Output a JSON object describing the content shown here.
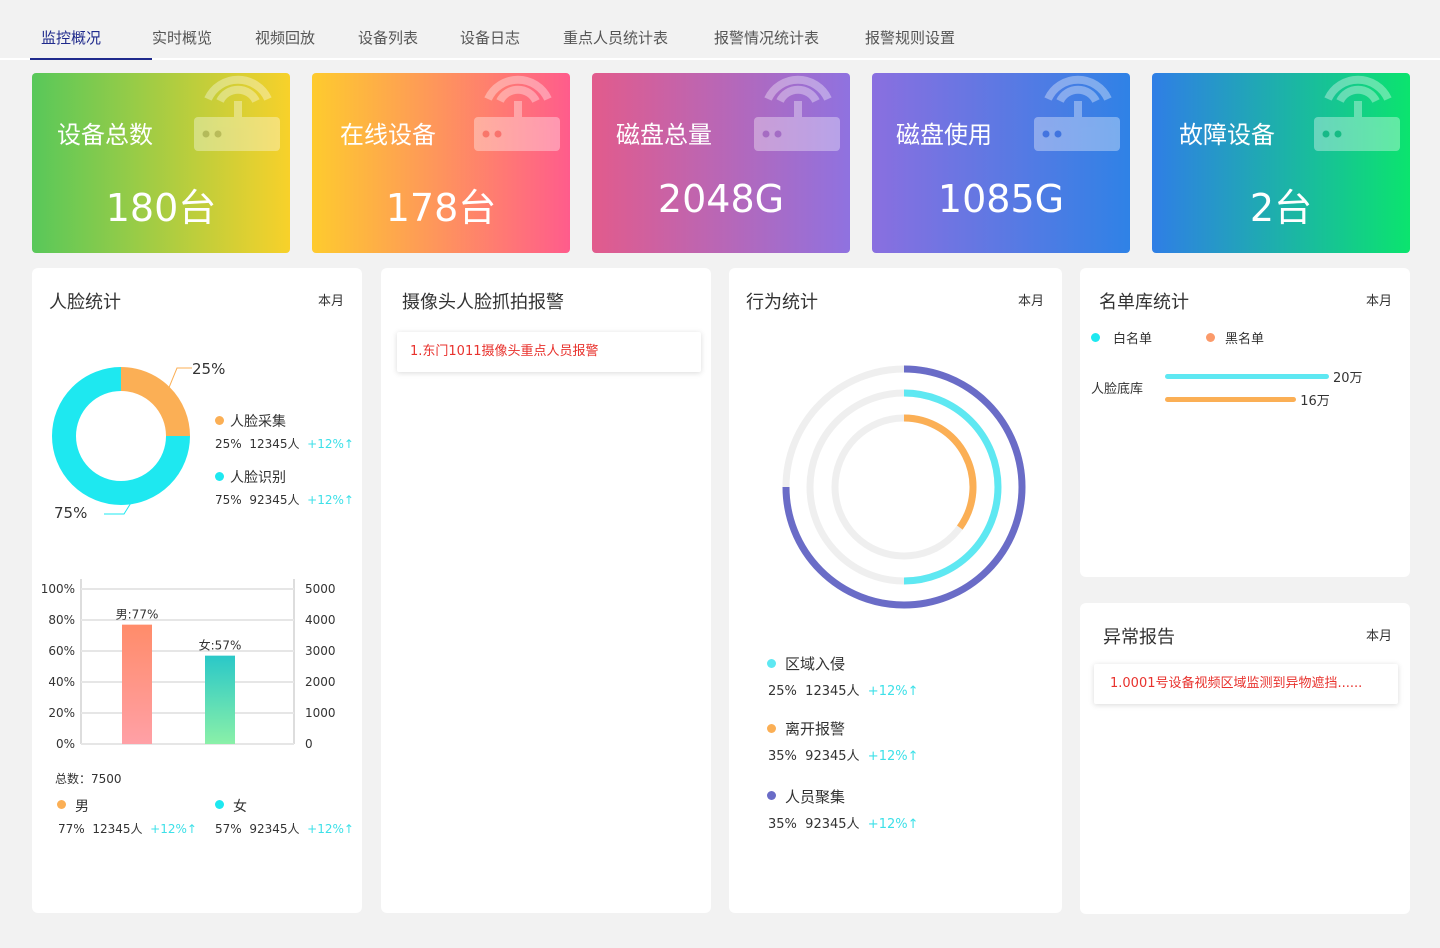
{
  "tabs": [
    "监控概况",
    "实时概览",
    "视频回放",
    "设备列表",
    "设备日志",
    "重点人员统计表",
    "报警情况统计表",
    "报警规则设置"
  ],
  "stats": [
    {
      "label": "设备总数",
      "value": "180台"
    },
    {
      "label": "在线设备",
      "value": "178台"
    },
    {
      "label": "磁盘总量",
      "value": "2048G"
    },
    {
      "label": "磁盘使用",
      "value": "1085G"
    },
    {
      "label": "故障设备",
      "value": "2台"
    }
  ],
  "face": {
    "title": "人脸统计",
    "period": "本月",
    "donut_top_label": "25%",
    "donut_bottom_label": "75%",
    "items": [
      {
        "name": "人脸采集",
        "pct": "25%",
        "count": "12345人",
        "trend": "+12%↑",
        "color": "#fbaf55"
      },
      {
        "name": "人脸识别",
        "pct": "75%",
        "count": "92345人",
        "trend": "+12%↑",
        "color": "#1ee8f0"
      }
    ]
  },
  "gender_chart": {
    "left_ticks": [
      "100%",
      "80%",
      "60%",
      "40%",
      "20%",
      "0%"
    ],
    "right_ticks": [
      "5000",
      "4000",
      "3000",
      "2000",
      "1000",
      "0"
    ],
    "bars": [
      {
        "label": "男:77%",
        "value": 77
      },
      {
        "label": "女:57%",
        "value": 57
      }
    ],
    "total": "总数：7500",
    "items": [
      {
        "name": "男",
        "pct": "77%",
        "count": "12345人",
        "trend": "+12%↑",
        "color": "#fbaf55"
      },
      {
        "name": "女",
        "pct": "57%",
        "count": "92345人",
        "trend": "+12%↑",
        "color": "#1ee8f0"
      }
    ]
  },
  "camera": {
    "title": "摄像头人脸抓拍报警",
    "alert": "1.东门1011摄像头重点人员报警"
  },
  "behavior": {
    "title": "行为统计",
    "period": "本月",
    "items": [
      {
        "name": "区域入侵",
        "pct": "25%",
        "count": "12345人",
        "trend": "+12%↑",
        "color": "#5ee8f2",
        "ratio": 0.5
      },
      {
        "name": "离开报警",
        "pct": "35%",
        "count": "92345人",
        "trend": "+12%↑",
        "color": "#fbaf55",
        "ratio": 0.35
      },
      {
        "name": "人员聚集",
        "pct": "35%",
        "count": "92345人",
        "trend": "+12%↑",
        "color": "#6a6cc7",
        "ratio": 0.75
      }
    ]
  },
  "roster": {
    "title": "名单库统计",
    "period": "本月",
    "legend": [
      {
        "name": "白名单",
        "color": "#1ee8f0"
      },
      {
        "name": "黑名单",
        "color": "#fb9a6a"
      }
    ],
    "row_label": "人脸底库",
    "bars": [
      {
        "value_label": "20万",
        "ratio": 1.0,
        "color": "#5ee8f2"
      },
      {
        "value_label": "16万",
        "ratio": 0.8,
        "color": "#fbaf55"
      }
    ]
  },
  "abnormal": {
    "title": "异常报告",
    "period": "本月",
    "alert": "1.0001号设备视频区域监测到异物遮挡......"
  }
}
